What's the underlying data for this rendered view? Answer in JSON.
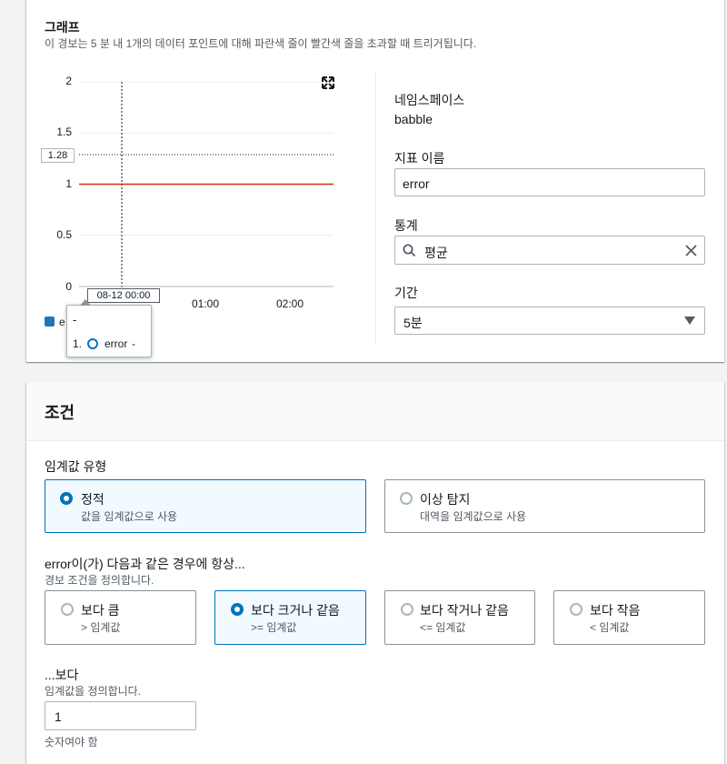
{
  "graph": {
    "title": "그래프",
    "description": "이 경보는 5 분 내 1개의 데이터 포인트에 대해 파란색 줄이 빨간색 줄을 초과할 때 트리거됩니다.",
    "y_ticks": [
      "2",
      "1.5",
      "1",
      "0.5",
      "0"
    ],
    "x_ticks": [
      "01:00",
      "02:00"
    ],
    "hover_y_label": "1.28",
    "hover_x_label": "08-12 00:00",
    "tooltip": {
      "title": "-",
      "index": "1.",
      "metric": "error",
      "value": "-"
    },
    "legend_partial": "e",
    "colors": {
      "threshold": "#d13212",
      "series": "#1f77b4"
    }
  },
  "chart_data": {
    "type": "line",
    "title": "",
    "xlabel": "",
    "ylabel": "",
    "ylim": [
      0,
      2
    ],
    "x": [
      "00:00",
      "01:00",
      "02:00"
    ],
    "series": [
      {
        "name": "error",
        "values": [
          null,
          null,
          null
        ]
      }
    ],
    "threshold": 1,
    "hover_value": 1.28
  },
  "metric": {
    "namespace_label": "네임스페이스",
    "namespace_value": "babble",
    "metric_name_label": "지표 이름",
    "metric_name_value": "error",
    "statistic_label": "통계",
    "statistic_value": "평균",
    "period_label": "기간",
    "period_value": "5분"
  },
  "conditions": {
    "header": "조건",
    "threshold_type_label": "임계값 유형",
    "threshold_types": [
      {
        "title": "정적",
        "desc": "값을 임계값으로 사용",
        "selected": true
      },
      {
        "title": "이상 탐지",
        "desc": "대역을 임계값으로 사용",
        "selected": false
      }
    ],
    "whenever_label": "error이(가) 다음과 같은 경우에 항상...",
    "whenever_desc": "경보 조건을 정의합니다.",
    "operators": [
      {
        "title": "보다 큼",
        "desc": "> 임계값",
        "selected": false
      },
      {
        "title": "보다 크거나 같음",
        "desc": ">= 임계값",
        "selected": true
      },
      {
        "title": "보다 작거나 같음",
        "desc": "<= 임계값",
        "selected": false
      },
      {
        "title": "보다 작음",
        "desc": "< 임계값",
        "selected": false
      }
    ],
    "than_label": "...보다",
    "than_desc": "임계값을 정의합니다.",
    "than_value": "1",
    "constraint": "숫자여야 함"
  }
}
